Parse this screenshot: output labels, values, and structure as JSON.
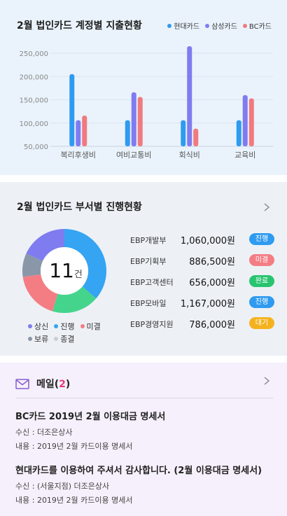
{
  "spending_card": {
    "title": "2월 법인카드 계정별 지출현황",
    "legend": [
      {
        "label": "현대카드",
        "color": "#2f9bf0"
      },
      {
        "label": "삼성카드",
        "color": "#7f7cf0"
      },
      {
        "label": "BC카드",
        "color": "#f07a7e"
      }
    ]
  },
  "chart_data": {
    "type": "bar",
    "categories": [
      "복리후생비",
      "여비교통비",
      "회식비",
      "교육비"
    ],
    "series": [
      {
        "name": "현대카드",
        "values": [
          205000,
          106000,
          106000,
          106000
        ]
      },
      {
        "name": "삼성카드",
        "values": [
          106000,
          166000,
          265000,
          160000
        ]
      },
      {
        "name": "BC카드",
        "values": [
          116000,
          156000,
          88000,
          153000
        ]
      }
    ],
    "yticks": [
      "250,000",
      "200,000",
      "150,000",
      "100,000",
      "50,000"
    ],
    "ylim": [
      50000,
      250000
    ],
    "colors": [
      "#2f9bf0",
      "#7f7cf0",
      "#f07a7e"
    ],
    "grid": true
  },
  "dept_card": {
    "title": "2월 법인카드 부서별 진행현황",
    "total_count": "11",
    "total_unit": "건",
    "donut": [
      {
        "label": "진행",
        "value": 4,
        "color": "#35a4f2"
      },
      {
        "label": "완료",
        "value": 2,
        "color": "#45d48c"
      },
      {
        "label": "미결",
        "value": 2,
        "color": "#f47d84"
      },
      {
        "label": "보류",
        "value": 1,
        "color": "#8a97a8"
      },
      {
        "label": "상신",
        "value": 2,
        "color": "#7f7cf0"
      }
    ],
    "legend_rows": [
      [
        {
          "label": "상신",
          "color": "#7f7cf0"
        },
        {
          "label": "진행",
          "color": "#35a4f2"
        },
        {
          "label": "미결",
          "color": "#f47d84"
        }
      ],
      [
        {
          "label": "보류",
          "color": "#8a97a8"
        },
        {
          "label": "종결",
          "color": "#c9ced6"
        }
      ]
    ],
    "departments": [
      {
        "name": "EBP개발부",
        "amount": "1,060,000원",
        "status": "진행",
        "color": "#2f9bf0"
      },
      {
        "name": "EBP기획부",
        "amount": "886,500원",
        "status": "미결",
        "color": "#f47d84"
      },
      {
        "name": "EBP고객센터",
        "amount": "656,000원",
        "status": "완료",
        "color": "#28c46f"
      },
      {
        "name": "EBP모바일",
        "amount": "1,167,000원",
        "status": "진행",
        "color": "#2f9bf0"
      },
      {
        "name": "EBP경영지원",
        "amount": "786,000원",
        "status": "대기",
        "color": "#f5b21e"
      }
    ]
  },
  "mail_card": {
    "title": "메일",
    "count": "2",
    "items": [
      {
        "subject": "BC카드 2019년 2월 이용대금 명세서",
        "recipient": "수신 : 더조은상사",
        "content": "내용 : 2019년 2월 카드이용 명세서"
      },
      {
        "subject": "현대카드를 이용하여 주셔서 감사합니다. (2월 이용대금 명세서)",
        "recipient": "수신 : (서울지점) 더조은상사",
        "content": "내용 : 2019년 2월 카드이용 명세서"
      }
    ]
  }
}
